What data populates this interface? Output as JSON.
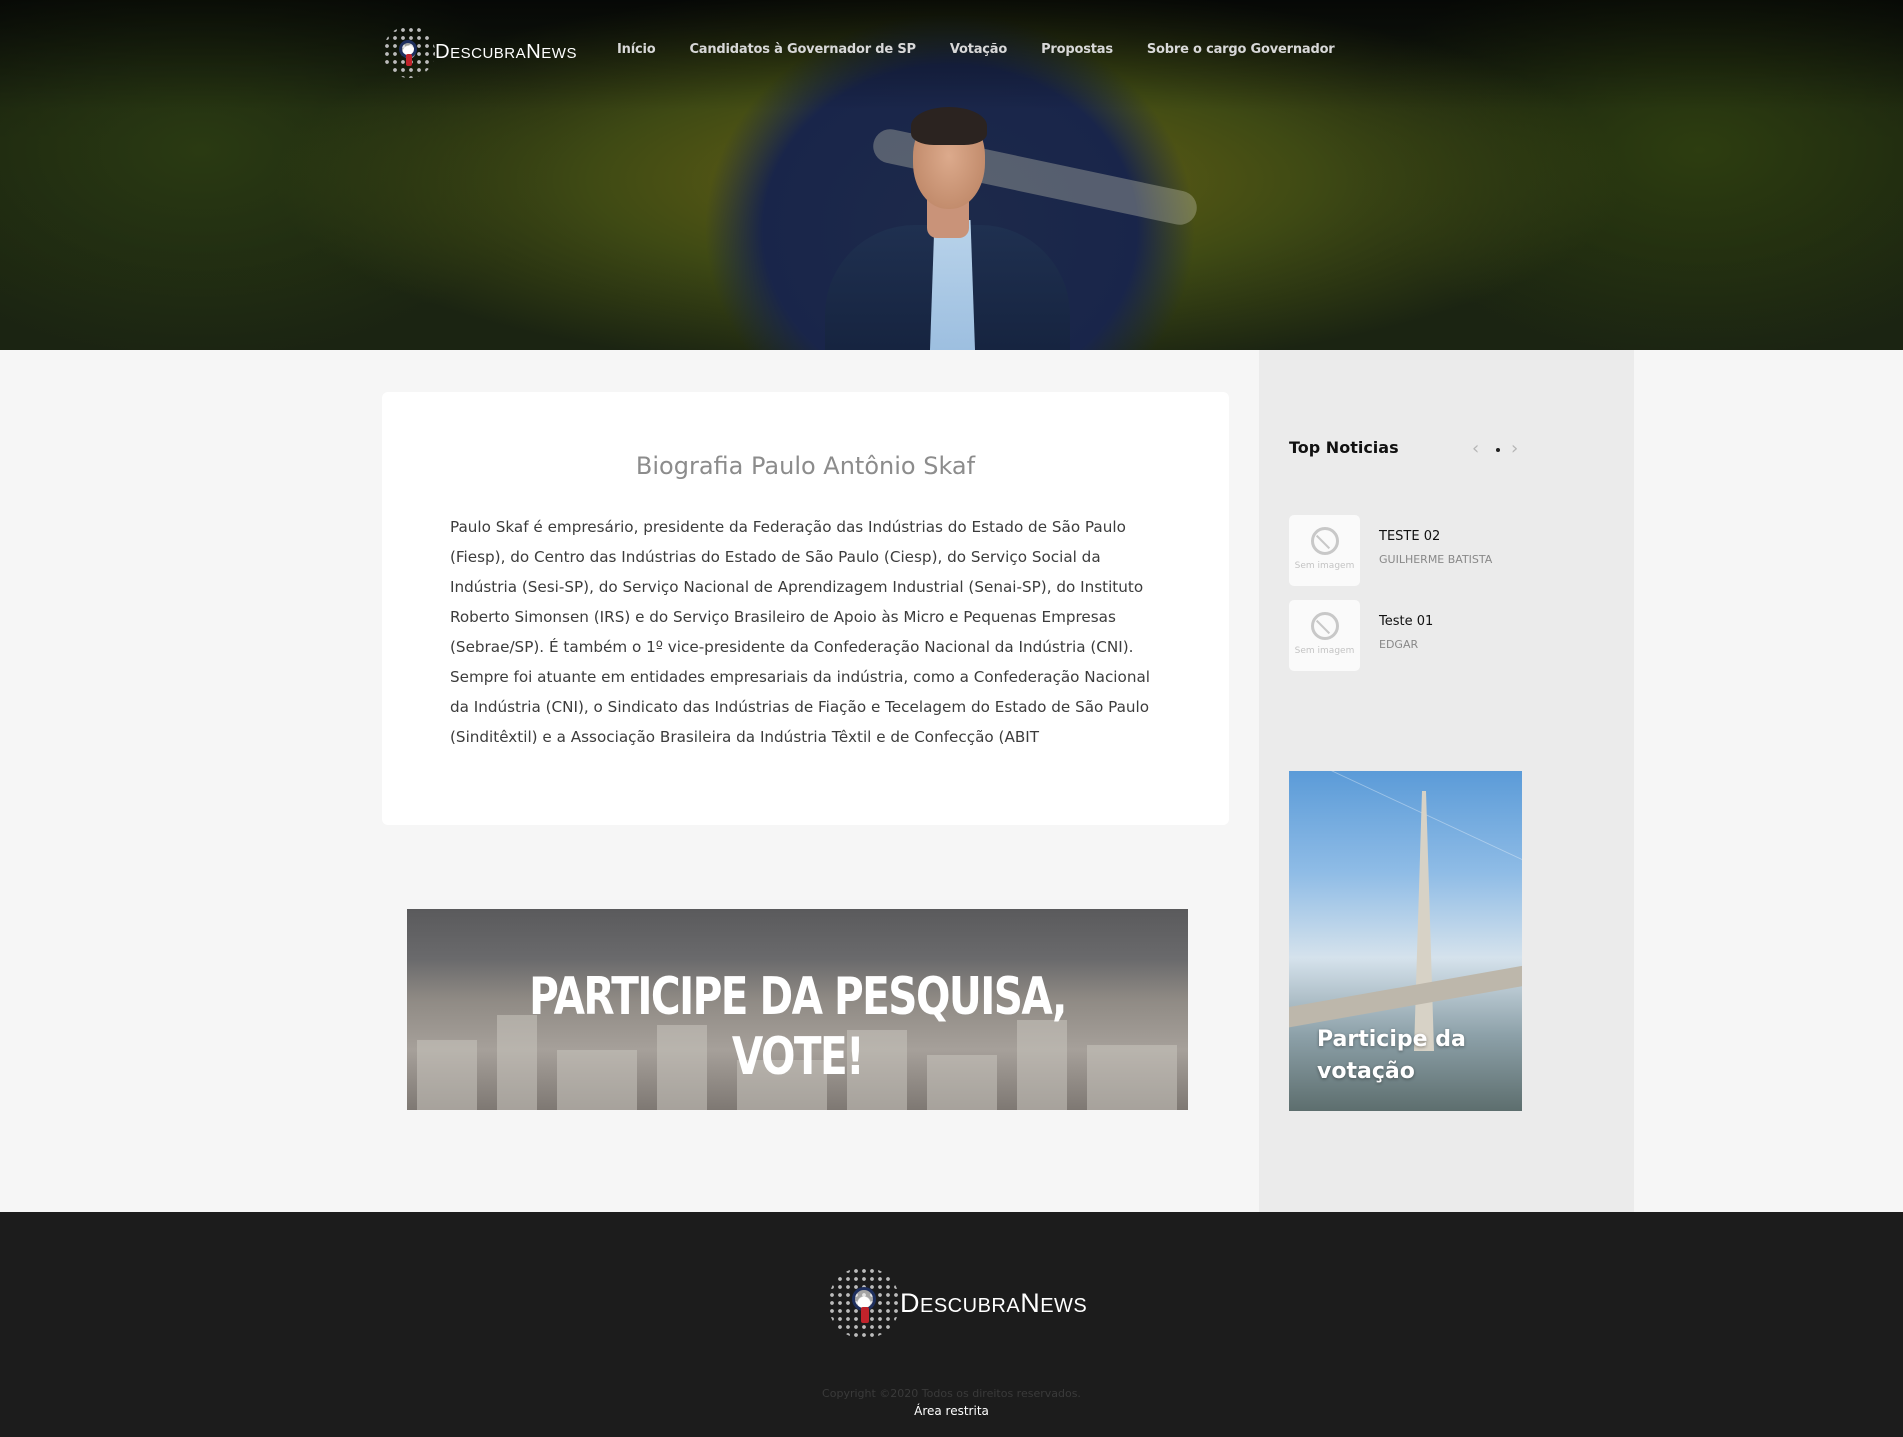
{
  "header": {
    "logo_text_first": "D",
    "logo_text_rest1": "ESCUBRA",
    "logo_text_cap2": "N",
    "logo_text_rest2": "EWS",
    "nav": [
      "Início",
      "Candidatos à Governador de SP",
      "Votação",
      "Propostas",
      "Sobre o cargo Governador"
    ]
  },
  "main": {
    "title": "Biografia Paulo Antônio Skaf",
    "body": "Paulo Skaf é empresário, presidente da Federação das Indústrias do Estado de São Paulo (Fiesp), do Centro das Indústrias do Estado de São Paulo (Ciesp), do Serviço Social da Indústria (Sesi-SP), do Serviço Nacional de Aprendizagem Industrial (Senai-SP), do Instituto Roberto Simonsen (IRS) e do Serviço Brasileiro de Apoio às Micro e Pequenas Empresas (Sebrae/SP). É também o 1º vice-presidente da Confederação Nacional da Indústria (CNI). Sempre foi atuante em entidades empresariais da indústria, como a Confederação Nacional da Indústria (CNI), o Sindicato das Indústrias de Fiação e Tecelagem do Estado de São Paulo (Sinditêxtil) e a Associação Brasileira da Indústria Têxtil e de Confecção (ABIT",
    "banner_text": "PARTICIPE DA PESQUISA, VOTE!"
  },
  "sidebar": {
    "title": "Top Noticias",
    "prev_icon": "‹",
    "next_icon": "›",
    "thumb_caption": "Sem imagem",
    "news": [
      {
        "title": "TESTE 02",
        "author": "GUILHERME BATISTA"
      },
      {
        "title": "Teste 01",
        "author": "EDGAR"
      }
    ],
    "promo_text": "Participe da votação"
  },
  "footer": {
    "copyright": "Copyright ©2020 Todos os direitos reservados.",
    "restricted": "Área restrita"
  }
}
